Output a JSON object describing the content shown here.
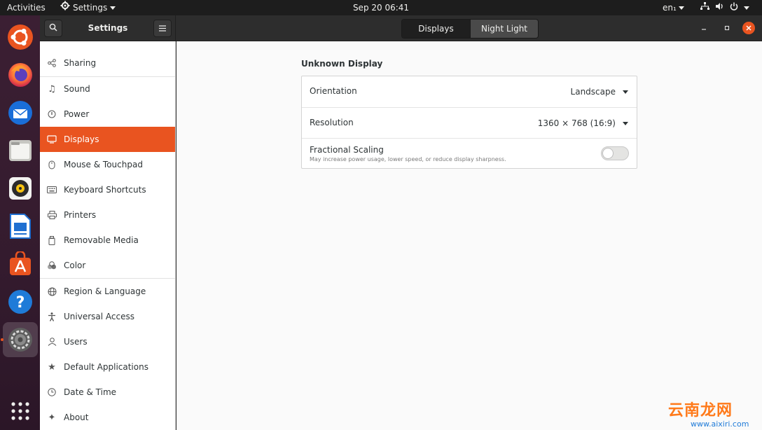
{
  "topbar": {
    "activities": "Activities",
    "app_name": "Settings",
    "clock": "Sep 20  06:41",
    "language": "en₁",
    "status_icons": [
      "network-icon",
      "volume-icon",
      "power-icon"
    ]
  },
  "dock": {
    "apps": [
      {
        "name": "ubuntu-logo-icon"
      },
      {
        "name": "firefox-icon"
      },
      {
        "name": "thunderbird-icon"
      },
      {
        "name": "files-icon"
      },
      {
        "name": "rhythmbox-icon"
      },
      {
        "name": "writer-icon"
      },
      {
        "name": "software-icon"
      },
      {
        "name": "help-icon"
      },
      {
        "name": "settings-icon",
        "active": true
      },
      {
        "name": "app-grid-icon"
      }
    ]
  },
  "header": {
    "title": "Settings",
    "tabs": [
      {
        "label": "Displays",
        "selected": true
      },
      {
        "label": "Night Light",
        "selected": false
      }
    ]
  },
  "sidebar": {
    "items": [
      {
        "label": "Sharing",
        "icon": "share-icon"
      },
      {
        "label": "Sound",
        "icon": "music-note-icon"
      },
      {
        "label": "Power",
        "icon": "power-icon"
      },
      {
        "label": "Displays",
        "icon": "display-icon",
        "selected": true
      },
      {
        "label": "Mouse & Touchpad",
        "icon": "mouse-icon"
      },
      {
        "label": "Keyboard Shortcuts",
        "icon": "keyboard-icon"
      },
      {
        "label": "Printers",
        "icon": "printer-icon"
      },
      {
        "label": "Removable Media",
        "icon": "media-icon"
      },
      {
        "label": "Color",
        "icon": "color-icon"
      },
      {
        "label": "Region & Language",
        "icon": "globe-icon"
      },
      {
        "label": "Universal Access",
        "icon": "accessibility-icon"
      },
      {
        "label": "Users",
        "icon": "users-icon"
      },
      {
        "label": "Default Applications",
        "icon": "star-icon"
      },
      {
        "label": "Date & Time",
        "icon": "clock-icon"
      },
      {
        "label": "About",
        "icon": "about-icon"
      }
    ]
  },
  "display": {
    "section_title": "Unknown Display",
    "orientation": {
      "label": "Orientation",
      "value": "Landscape"
    },
    "resolution": {
      "label": "Resolution",
      "value": "1360 × 768 (16:9)"
    },
    "fractional_scaling": {
      "label": "Fractional Scaling",
      "description": "May increase power usage, lower speed, or reduce display sharpness.",
      "enabled": false
    }
  },
  "watermark": {
    "text": "云南龙网",
    "url": "www.aixiri.com"
  },
  "colors": {
    "accent": "#e95420",
    "dock": "#3b1f33",
    "headerbar": "#2d2d2d"
  }
}
